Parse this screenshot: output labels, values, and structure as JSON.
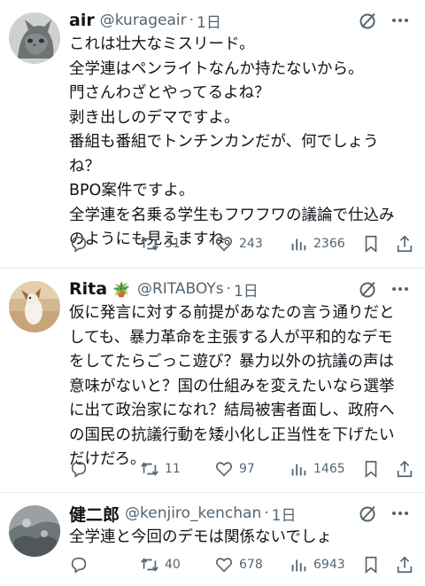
{
  "tweets": [
    {
      "name": "air",
      "handle": "@kurageair",
      "time": "1日",
      "dot": "·",
      "lines": [
        "これは壮大なミスリード。",
        "全学連はペンライトなんか持たないから。",
        "門さんわざとやってるよね？",
        "剥き出しのデマですよ。",
        "番組も番組でトンチンカンだが、何でしょう",
        "ね？",
        "BPO案件ですよ。",
        "全学連を名乗る学生もフワフワの議論で仕込み",
        "のようにも見えますね。"
      ],
      "replies": "",
      "retweets": "31",
      "likes": "243",
      "views": "2366"
    },
    {
      "name": "Rita",
      "emoji": "🪴",
      "handle": "@RITABOYs",
      "time": "1日",
      "dot": "·",
      "lines": [
        "仮に発言に対する前提があなたの言う通りだと",
        "しても、暴力革命を主張する人が平和的なデモ",
        "をしてたらごっこ遊び？暴力以外の抗議の声は",
        "意味がないと？国の仕組みを変えたいなら選挙",
        "に出て政治家になれ？結局被害者面し、政府へ",
        "の国民の抗議行動を矮小化し正当性を下げたい",
        "だけだろ。"
      ],
      "replies": "",
      "retweets": "11",
      "likes": "97",
      "views": "1465"
    },
    {
      "name": "健二郎",
      "handle": "@kenjiro_kenchan",
      "time": "1日",
      "dot": "·",
      "lines": [
        "全学連と今回のデモは関係ないでしょ"
      ],
      "replies": "",
      "retweets": "40",
      "likes": "678",
      "views": "6943"
    }
  ],
  "icons": {
    "grok": "grok-icon",
    "more": "more-icon",
    "reply": "reply-icon",
    "retweet": "retweet-icon",
    "like": "like-icon",
    "views": "views-icon",
    "bookmark": "bookmark-icon",
    "share": "share-icon"
  },
  "colors": {
    "text": "#0f1419",
    "secondary": "#536471",
    "divider": "#e6e9ec"
  }
}
